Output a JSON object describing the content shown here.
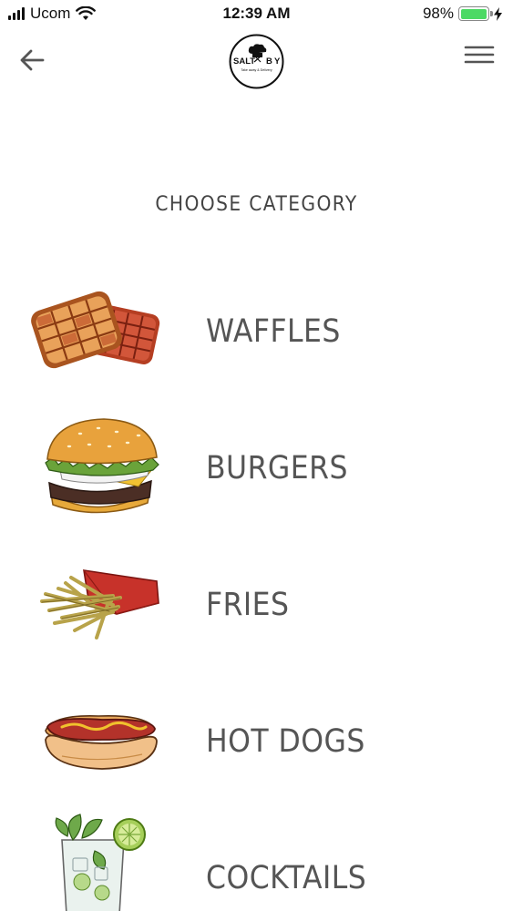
{
  "status_bar": {
    "carrier": "Ucom",
    "time": "12:39 AM",
    "battery_percent": "98%",
    "battery_level": 0.98,
    "battery_color": "#4cd964"
  },
  "nav": {
    "back_icon": "arrow-left-icon",
    "menu_icon": "hamburger-menu-icon",
    "logo": {
      "text_left": "SALT",
      "text_right": "B",
      "text_right_end": "Y",
      "tagline": "Take away & Delivery"
    }
  },
  "page": {
    "title": "CHOOSE CATEGORY"
  },
  "categories": [
    {
      "label": "WAFFLES",
      "icon": "waffles-illustration"
    },
    {
      "label": "BURGERS",
      "icon": "burger-illustration"
    },
    {
      "label": "FRIES",
      "icon": "fries-illustration"
    },
    {
      "label": "HOT DOGS",
      "icon": "hotdog-illustration"
    },
    {
      "label": "COCKTAILS",
      "icon": "cocktail-illustration"
    }
  ],
  "colors": {
    "text_primary": "#555555",
    "title": "#444444",
    "icon": "#555555"
  }
}
